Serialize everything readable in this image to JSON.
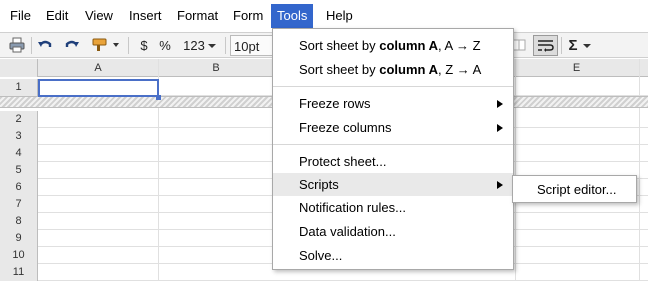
{
  "menubar": {
    "items": [
      "File",
      "Edit",
      "View",
      "Insert",
      "Format",
      "Form",
      "Tools",
      "Help"
    ],
    "active": "Tools"
  },
  "toolbar": {
    "icons": [
      "print-icon",
      "undo-icon",
      "redo-icon",
      "paint-format-icon"
    ],
    "currency_label": "$",
    "percent_label": "%",
    "number_format_label": "123",
    "font_size_label": "10pt",
    "sum_label": "Σ"
  },
  "grid": {
    "columns": [
      "A",
      "B",
      "E"
    ],
    "rows": [
      "1",
      "2",
      "3",
      "4",
      "5",
      "6",
      "7",
      "8",
      "9",
      "10",
      "11"
    ],
    "selected_cell": "A1"
  },
  "tools_menu": {
    "sort_az": {
      "prefix": "Sort sheet by ",
      "column": "column A",
      "suffix": ", A → Z"
    },
    "sort_za": {
      "prefix": "Sort sheet by ",
      "column": "column A",
      "suffix": ", Z → A"
    },
    "freeze_rows": "Freeze rows",
    "freeze_columns": "Freeze columns",
    "protect_sheet": "Protect sheet...",
    "scripts": "Scripts",
    "notification_rules": "Notification rules...",
    "data_validation": "Data validation...",
    "solve": "Solve..."
  },
  "scripts_submenu": {
    "script_editor": "Script editor..."
  },
  "colors": {
    "menu_active": "#3366cc",
    "selection": "#4a6fc7"
  }
}
